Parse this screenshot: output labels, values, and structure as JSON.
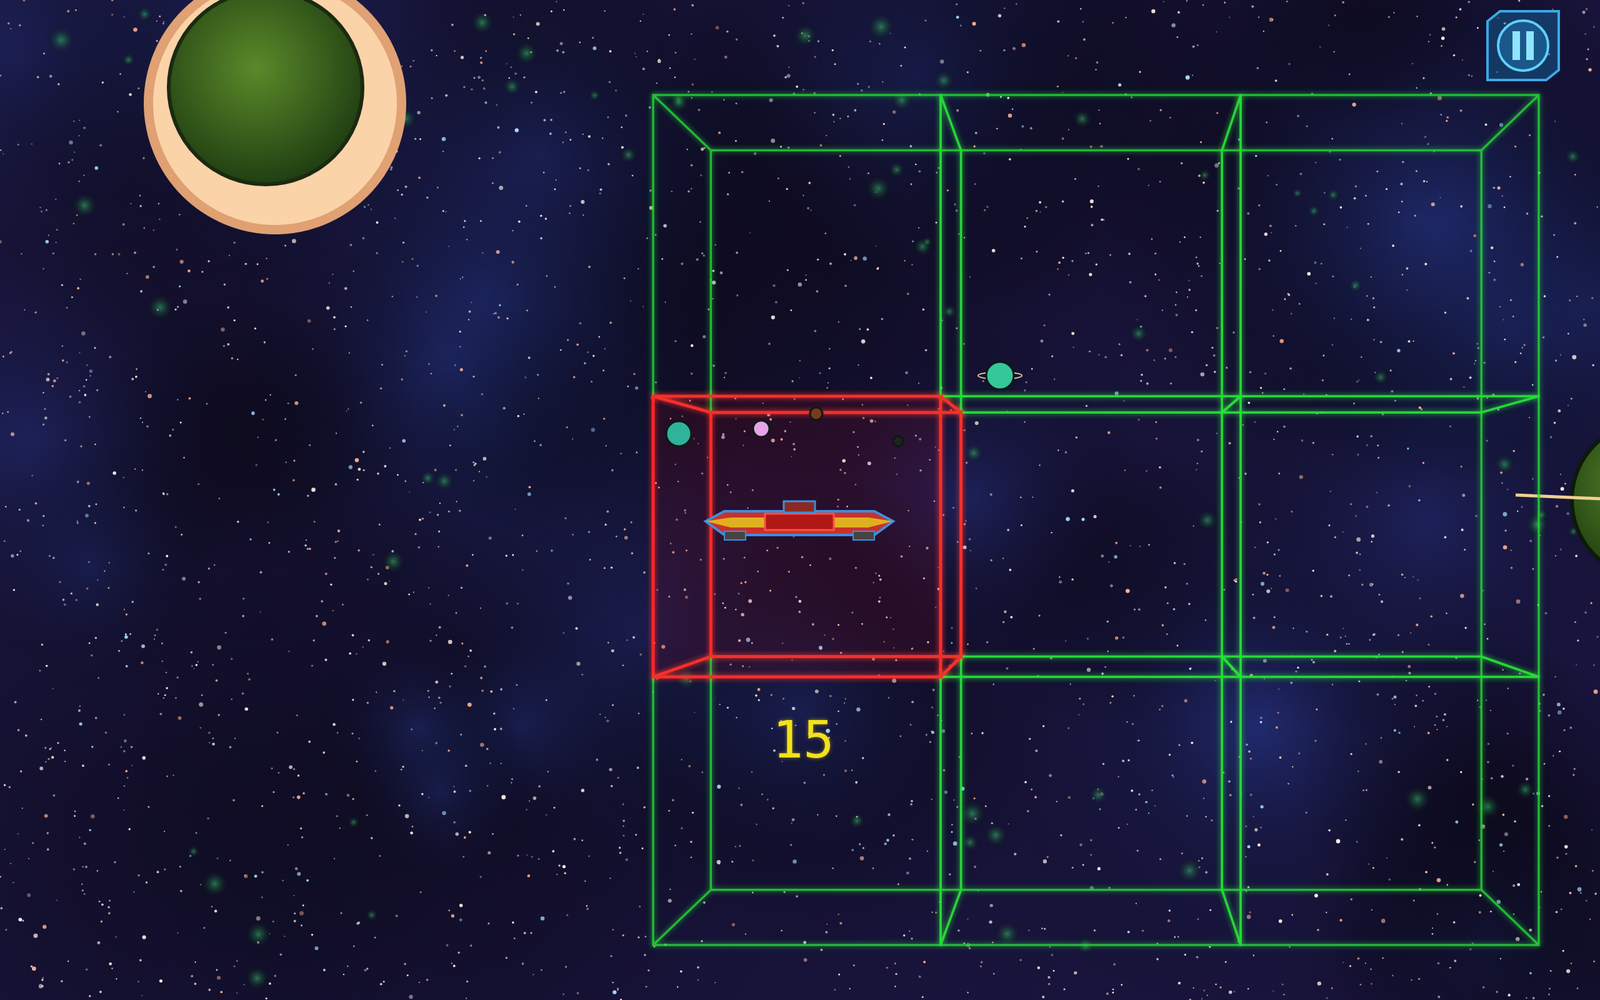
{
  "score": "15",
  "grid": {
    "cells": [
      {
        "selected": false
      },
      {
        "selected": false
      },
      {
        "selected": false
      },
      {
        "selected": true
      },
      {
        "selected": false
      },
      {
        "selected": false
      },
      {
        "selected": false
      },
      {
        "selected": false
      },
      {
        "selected": false
      }
    ]
  }
}
